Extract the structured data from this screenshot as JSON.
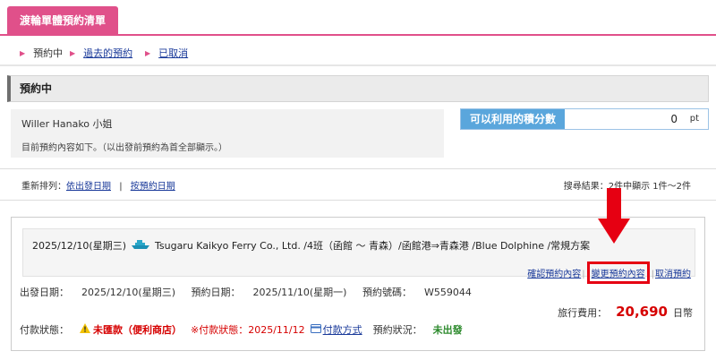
{
  "header": {
    "title": "渡輪單體預約清單"
  },
  "tabs": [
    {
      "label": "預約中",
      "current": true
    },
    {
      "label": "過去的預約",
      "current": false
    },
    {
      "label": "已取消",
      "current": false
    }
  ],
  "section": {
    "title": "預約中"
  },
  "user": {
    "name": "Willer Hanako 小姐",
    "note": "目前預約內容如下。（以出發前預約為首全部顯示。）"
  },
  "points": {
    "label": "可以利用的積分數",
    "value": "0",
    "unit": "pt"
  },
  "sort": {
    "prefix": "重新排列：",
    "by_departure": "依出發日期",
    "separator": "|",
    "by_booking": "按預約日期"
  },
  "results": {
    "text": "搜尋結果：2件中顯示 1件～2件"
  },
  "reservation": {
    "route_date": "2025/12/10(星期三)",
    "route_text": "Tsugaru Kaikyo Ferry Co., Ltd. /4班（函館 ～ 青森）/函館港⇒青森港 /Blue Dolphine /常規方案",
    "actions": {
      "confirm": "確認預約內容",
      "change": "變更預約內容",
      "cancel": "取消預約"
    },
    "departure_label": "出發日期：",
    "departure_value": "2025/12/10(星期三)",
    "booking_label": "預約日期：",
    "booking_value": "2025/11/10(星期一)",
    "number_label": "預約號碼：",
    "number_value": "W559044",
    "fare_label": "旅行費用：",
    "fare_value": "20,690",
    "fare_unit": "日幣",
    "payment_label": "付款狀態：",
    "payment_status": "未匯款（便利商店）",
    "deadline_text": "※付款狀態：2025/11/12",
    "payment_method": "付款方式",
    "status_label": "預約狀況：",
    "status_value": "未出發"
  },
  "colors": {
    "brand_pink": "#e0508a",
    "accent_blue": "#5aa6dc",
    "alert_red": "#d60000",
    "highlight_red": "#e60012",
    "status_green": "#2e8b2e"
  },
  "icons": [
    "ferry-icon",
    "warning-icon",
    "credit-card-icon",
    "down-arrow-icon"
  ]
}
